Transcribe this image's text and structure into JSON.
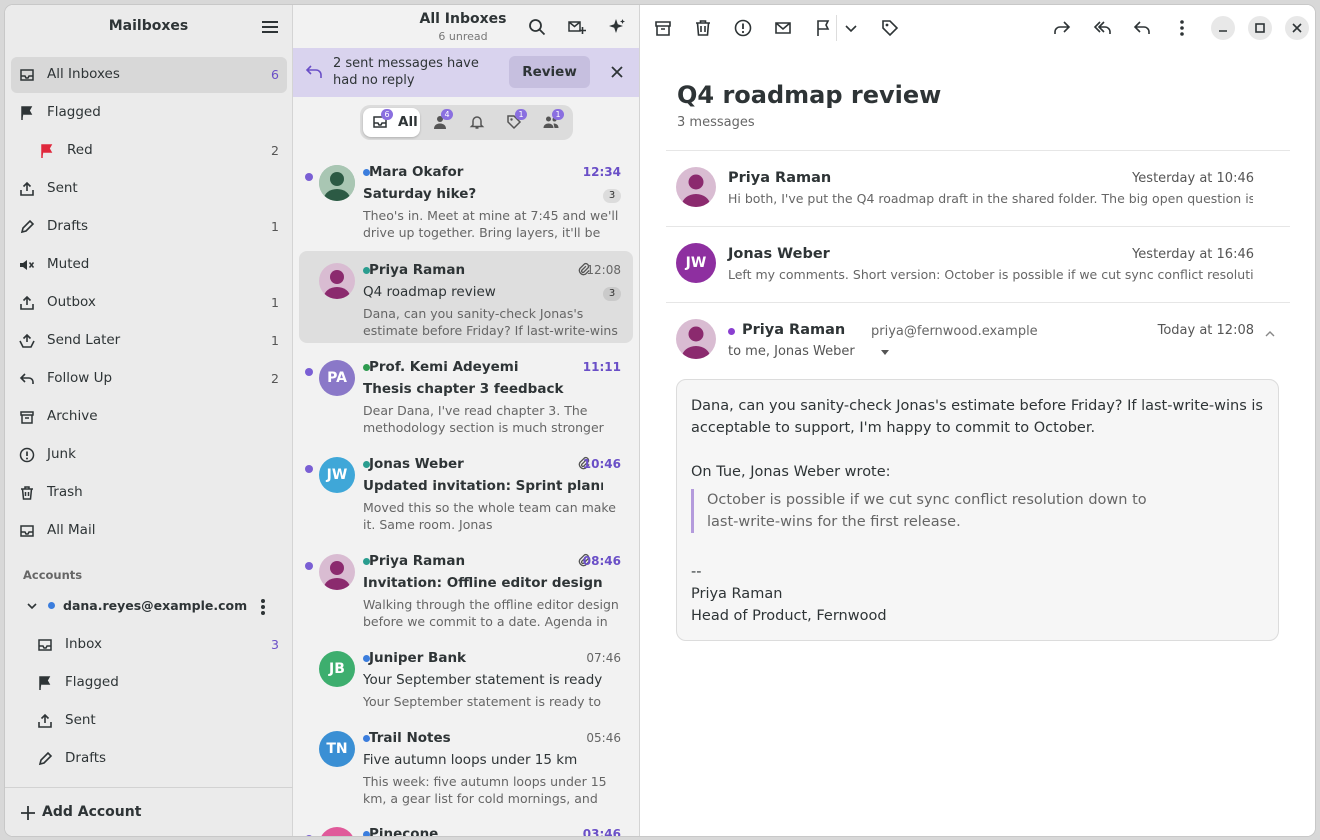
{
  "sidebar": {
    "title": "Mailboxes",
    "items": [
      {
        "label": "All Inboxes",
        "count": "6",
        "icon": "inbox-icon"
      },
      {
        "label": "Flagged",
        "count": "",
        "icon": "flag-icon"
      },
      {
        "label": "Red",
        "count": "2",
        "icon": "red-flag-icon"
      },
      {
        "label": "Sent",
        "count": "",
        "icon": "sent-icon"
      },
      {
        "label": "Drafts",
        "count": "1",
        "icon": "pencil-icon"
      },
      {
        "label": "Muted",
        "count": "",
        "icon": "muted-icon"
      },
      {
        "label": "Outbox",
        "count": "1",
        "icon": "outbox-icon"
      },
      {
        "label": "Send Later",
        "count": "1",
        "icon": "send-later-icon"
      },
      {
        "label": "Follow Up",
        "count": "2",
        "icon": "reply-icon"
      },
      {
        "label": "Archive",
        "count": "",
        "icon": "archive-icon"
      },
      {
        "label": "Junk",
        "count": "",
        "icon": "junk-icon"
      },
      {
        "label": "Trash",
        "count": "",
        "icon": "trash-icon"
      },
      {
        "label": "All Mail",
        "count": "",
        "icon": "all-mail-icon"
      }
    ],
    "accounts_label": "Accounts",
    "account": {
      "email": "dana.reyes@example.com",
      "color": "#3b7ddd"
    },
    "account_items": [
      {
        "label": "Inbox",
        "count": "3"
      },
      {
        "label": "Flagged",
        "count": ""
      },
      {
        "label": "Sent",
        "count": ""
      },
      {
        "label": "Drafts",
        "count": ""
      }
    ],
    "add_account": "Add Account"
  },
  "list": {
    "title": "All Inboxes",
    "subtitle": "6 unread",
    "banner": {
      "text": "2 sent messages have had no reply",
      "button": "Review"
    },
    "filters": {
      "all_label": "All",
      "badges": [
        "6",
        "4",
        "",
        "1",
        "1"
      ]
    },
    "messages": [
      {
        "from": "Mara Okafor",
        "time": "12:34",
        "subject": "Saturday hike?",
        "count": "3",
        "preview": "Theo's in. Meet at mine at 7:45 and we'll drive up together. Bring layers, it'll be cold at the top.",
        "unread": true,
        "attach": false,
        "dot": "#3b7ddd"
      },
      {
        "from": "Priya Raman",
        "time": "12:08",
        "subject": "Q4 roadmap review",
        "count": "3",
        "preview": "Dana, can you sanity-check Jonas's estimate before Friday? If last-write-wins is acceptable to support,",
        "unread": false,
        "attach": true,
        "dot": "#2a9d8f"
      },
      {
        "from": "Prof. Kemi Adeyemi",
        "time": "11:11",
        "subject": "Thesis chapter 3 feedback",
        "count": "",
        "preview": "Dear Dana, I've read chapter 3. The methodology section is much stronger than the previous draft.",
        "unread": true,
        "attach": false,
        "dot": "#2e9b4f",
        "initials": "PA",
        "avcolor": "#8a78c8"
      },
      {
        "from": "Jonas Weber",
        "time": "10:46",
        "subject": "Updated invitation: Sprint planning",
        "count": "",
        "preview": "Moved this so the whole team can make it. Same room. Jonas",
        "unread": true,
        "attach": true,
        "dot": "#2a9d8f",
        "initials": "JW",
        "avcolor": "#3fa7d8"
      },
      {
        "from": "Priya Raman",
        "time": "08:46",
        "subject": "Invitation: Offline editor design review",
        "count": "",
        "preview": "Walking through the offline editor design before we commit to a date. Agenda in the doc.",
        "unread": true,
        "attach": true,
        "dot": "#2a9d8f"
      },
      {
        "from": "Juniper Bank",
        "time": "07:46",
        "subject": "Your September statement is ready",
        "count": "",
        "preview": "Your September statement is ready to view.",
        "unread": false,
        "attach": false,
        "dot": "#3b7ddd",
        "initials": "JB",
        "avcolor": "#3dae6e"
      },
      {
        "from": "Trail Notes",
        "time": "05:46",
        "subject": "Five autumn loops under 15 km",
        "count": "",
        "preview": "This week: five autumn loops under 15 km, a gear list for cold mornings, and where the leaves peak.",
        "unread": false,
        "attach": false,
        "dot": "#3b7ddd",
        "initials": "TN",
        "avcolor": "#3a8fd4"
      },
      {
        "from": "Pinecone",
        "time": "03:46",
        "subject": "",
        "count": "",
        "preview": "",
        "unread": true,
        "attach": false,
        "dot": "#3b7ddd",
        "initials": "P",
        "avcolor": "#e05a9a"
      }
    ]
  },
  "reader": {
    "title": "Q4 roadmap review",
    "count": "3 messages",
    "headers": [
      {
        "name": "Priya Raman",
        "time": "Yesterday at 10:46",
        "preview": "Hi both, I've put the Q4 roadmap draft in the shared folder. The big open question is whether offline sync lands this quarter."
      },
      {
        "name": "Jonas Weber",
        "time": "Yesterday at 16:46",
        "preview": "Left my comments. Short version: October is possible if we cut sync conflict resolution down to last-write-wins.",
        "initials": "JW"
      }
    ],
    "open": {
      "name": "Priya Raman",
      "email": "priya@fernwood.example",
      "time": "Today at 12:08",
      "to": "to me, Jonas Weber",
      "body1": "Dana, can you sanity-check Jonas's estimate before Friday? If last-write-wins is acceptable to support, I'm happy to commit to October.",
      "quote_intro": "On Tue, Jonas Weber wrote:",
      "quote": "October is possible if we cut sync conflict resolution down to last-write-wins for the first release.",
      "sig_sep": "--",
      "sig_name": "Priya Raman",
      "sig_title": "Head of Product, Fernwood"
    }
  }
}
